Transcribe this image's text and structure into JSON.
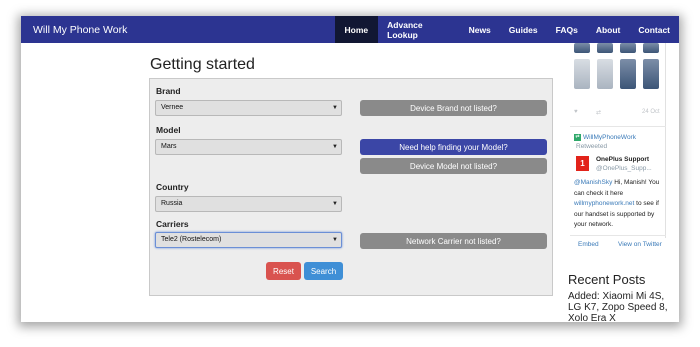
{
  "navbar": {
    "brand": "Will My Phone Work",
    "items": [
      "Home",
      "Advance Lookup",
      "News",
      "Guides",
      "FAQs",
      "About",
      "Contact"
    ],
    "active": "Home"
  },
  "main": {
    "title": "Getting started",
    "brand": {
      "label": "Brand",
      "value": "Vernee",
      "not_listed": "Device Brand not listed?"
    },
    "model": {
      "label": "Model",
      "value": "Mars",
      "help": "Need help finding your Model?",
      "not_listed": "Device Model not listed?"
    },
    "country": {
      "label": "Country",
      "value": "Russia"
    },
    "carriers": {
      "label": "Carriers",
      "value": "Tele2 (Rostelecom)",
      "not_listed": "Network Carrier not listed?"
    },
    "reset_label": "Reset",
    "search_label": "Search"
  },
  "sidebar": {
    "tweet_meta": {
      "heart": "♥",
      "retweet": "⇄",
      "date": "24 Oct"
    },
    "retweeter": "WillMyPhoneWork",
    "retweeted_label": "Retweeted",
    "account_name": "OnePlus Support",
    "account_handle": "@OnePlus_Supp...",
    "tweet": {
      "mention": "@ManishSky",
      "line1": " Hi, Manish! You can check it here ",
      "link": "willmyphonework.net",
      "line2": " to see if our handset is supported by your network."
    },
    "embed_label": "Embed",
    "view_label": "View on Twitter",
    "recent_title": "Recent Posts",
    "recent_post": "Added: Xiaomi Mi 4S, LG K7, Zopo Speed 8, Xolo Era X"
  },
  "colors": {
    "navbar": "#2c3491",
    "nav_active": "#111733",
    "gray_button": "#8a8a8a",
    "blue_button": "#3b46a6",
    "reset": "#d9534f",
    "search": "#3f8fd6"
  }
}
